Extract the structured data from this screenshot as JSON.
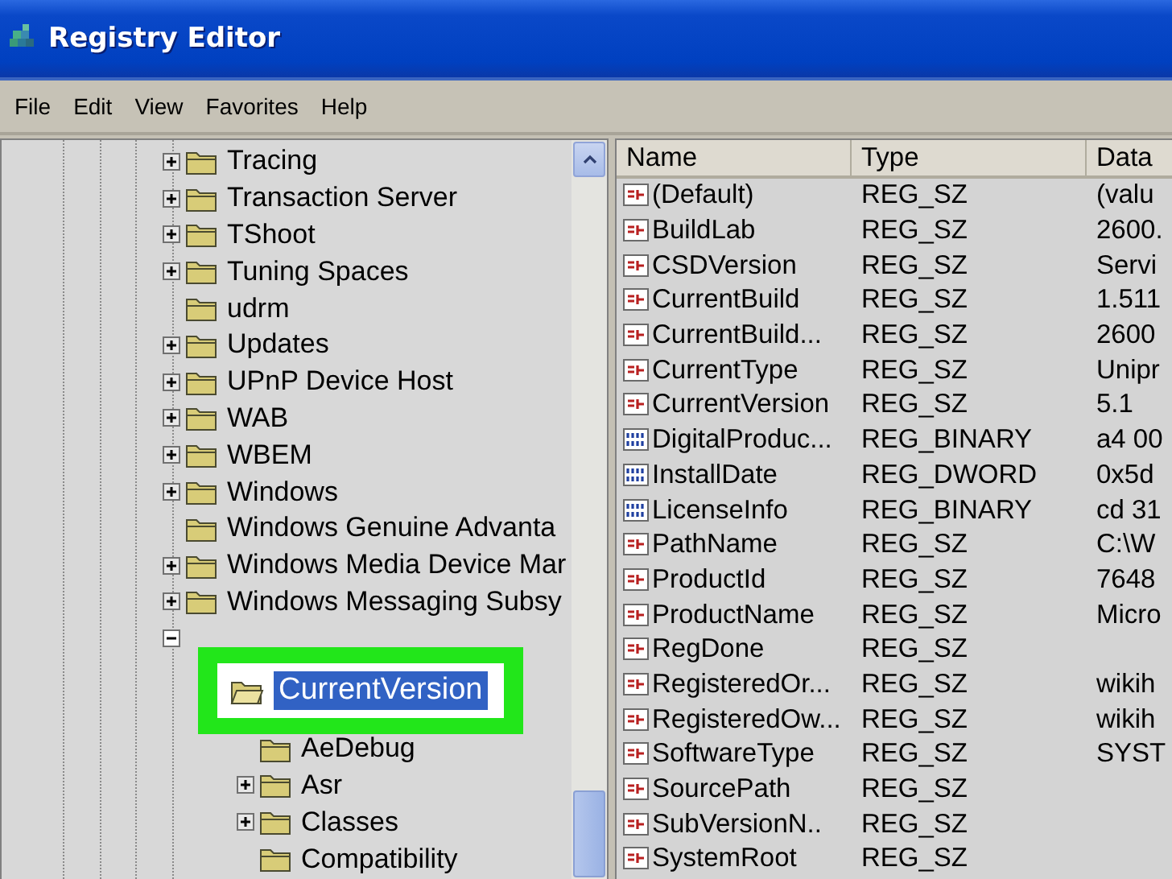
{
  "window": {
    "title": "Registry Editor"
  },
  "menu": [
    "File",
    "Edit",
    "View",
    "Favorites",
    "Help"
  ],
  "tree": {
    "items": [
      {
        "label": "Tracing",
        "expanded": false,
        "selected": false
      },
      {
        "label": "Transaction Server",
        "expanded": false,
        "selected": false
      },
      {
        "label": "TShoot",
        "expanded": false,
        "selected": false
      },
      {
        "label": "Tuning Spaces",
        "expanded": false,
        "selected": false
      },
      {
        "label": "udrm",
        "selected": false
      },
      {
        "label": "Updates",
        "expanded": false,
        "selected": false
      },
      {
        "label": "UPnP Device Host",
        "expanded": false,
        "selected": false
      },
      {
        "label": "WAB",
        "expanded": false,
        "selected": false
      },
      {
        "label": "WBEM",
        "expanded": false,
        "selected": false
      },
      {
        "label": "Windows",
        "expanded": false,
        "selected": false
      },
      {
        "label": "Windows Genuine Advanta",
        "selected": false
      },
      {
        "label": "Windows Media Device Mar",
        "expanded": false,
        "selected": false
      },
      {
        "label": "Windows Messaging Subsy",
        "expanded": false,
        "selected": false
      },
      {
        "expanded": true,
        "selected": false,
        "children": [
          {
            "label": "CurrentVersion",
            "expanded": true,
            "selected": true,
            "children": [
              {
                "label": "AeDebug",
                "selected": false
              },
              {
                "label": "Asr",
                "expanded": false,
                "selected": false
              },
              {
                "label": "Classes",
                "expanded": false,
                "selected": false
              },
              {
                "label": "Compatibility",
                "selected": false
              }
            ]
          }
        ]
      }
    ]
  },
  "values": {
    "columns": [
      "Name",
      "Type",
      "Data"
    ],
    "rows": [
      {
        "kind": "string",
        "name": "(Default)",
        "type": "REG_SZ",
        "data": "(valu"
      },
      {
        "kind": "string",
        "name": "BuildLab",
        "type": "REG_SZ",
        "data": "2600."
      },
      {
        "kind": "string",
        "name": "CSDVersion",
        "type": "REG_SZ",
        "data": "Servi"
      },
      {
        "kind": "string",
        "name": "CurrentBuild",
        "type": "REG_SZ",
        "data": "1.511"
      },
      {
        "kind": "string",
        "name": "CurrentBuild...",
        "type": "REG_SZ",
        "data": "2600"
      },
      {
        "kind": "string",
        "name": "CurrentType",
        "type": "REG_SZ",
        "data": "Unipr"
      },
      {
        "kind": "string",
        "name": "CurrentVersion",
        "type": "REG_SZ",
        "data": "5.1"
      },
      {
        "kind": "binary",
        "name": "DigitalProduc...",
        "type": "REG_BINARY",
        "data": "a4 00"
      },
      {
        "kind": "binary",
        "name": "InstallDate",
        "type": "REG_DWORD",
        "data": "0x5d"
      },
      {
        "kind": "binary",
        "name": "LicenseInfo",
        "type": "REG_BINARY",
        "data": "cd 31"
      },
      {
        "kind": "string",
        "name": "PathName",
        "type": "REG_SZ",
        "data": "C:\\W"
      },
      {
        "kind": "string",
        "name": "ProductId",
        "type": "REG_SZ",
        "data": "7648"
      },
      {
        "kind": "string",
        "name": "ProductName",
        "type": "REG_SZ",
        "data": "Micro"
      },
      {
        "kind": "string",
        "name": "RegDone",
        "type": "REG_SZ"
      },
      {
        "kind": "string",
        "name": "RegisteredOr...",
        "type": "REG_SZ",
        "data": "wikih"
      },
      {
        "kind": "string",
        "name": "RegisteredOw...",
        "type": "REG_SZ",
        "data": "wikih"
      },
      {
        "kind": "string",
        "name": "SoftwareType",
        "type": "REG_SZ",
        "data": "SYST"
      },
      {
        "kind": "string",
        "name": "SourcePath",
        "type": "REG_SZ"
      },
      {
        "kind": "string",
        "name": "SubVersionN..",
        "type": "REG_SZ"
      },
      {
        "kind": "string",
        "name": "SystemRoot",
        "type": "REG_SZ"
      }
    ]
  }
}
